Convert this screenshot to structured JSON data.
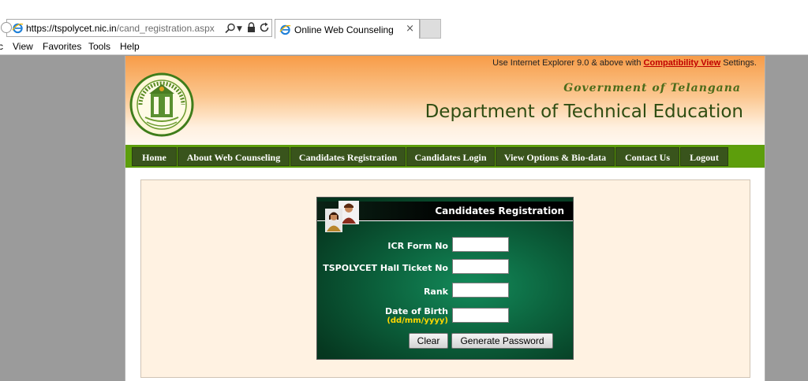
{
  "browser": {
    "url_host": "https://tspolycet.nic.in",
    "url_path": "/cand_registration.aspx",
    "tab_title": "Online Web Counseling",
    "tab_close": "×",
    "menu": [
      "View",
      "Favorites",
      "Tools",
      "Help"
    ],
    "menu_clipped": "c"
  },
  "header": {
    "notice_prefix": "Use Internet Explorer 9.0 & above with",
    "notice_link": "Compatibility View",
    "notice_suffix": "Settings.",
    "gov_title": "Government of Telangana",
    "dept_title": "Department of Technical Education"
  },
  "nav": {
    "items": [
      "Home",
      "About Web Counseling",
      "Candidates Registration",
      "Candidates Login",
      "View Options & Bio-data",
      "Contact Us",
      "Logout"
    ]
  },
  "form": {
    "title": "Candidates Registration",
    "icr_label": "ICR Form No",
    "icr_value": "",
    "hall_ticket_label": "TSPOLYCET Hall Ticket No",
    "hall_ticket_value": "",
    "rank_label": "Rank",
    "rank_value": "",
    "dob_label": "Date of Birth",
    "dob_format": "(dd/mm/yyyy)",
    "dob_value": "",
    "clear_label": "Clear",
    "generate_label": "Generate Password"
  },
  "colors": {
    "nav_bg": "#5d9e0c",
    "nav_item": "#39541c",
    "dept_title": "#2f4d12",
    "panel_green": "#0b5e3a",
    "link_red": "#c00000"
  }
}
